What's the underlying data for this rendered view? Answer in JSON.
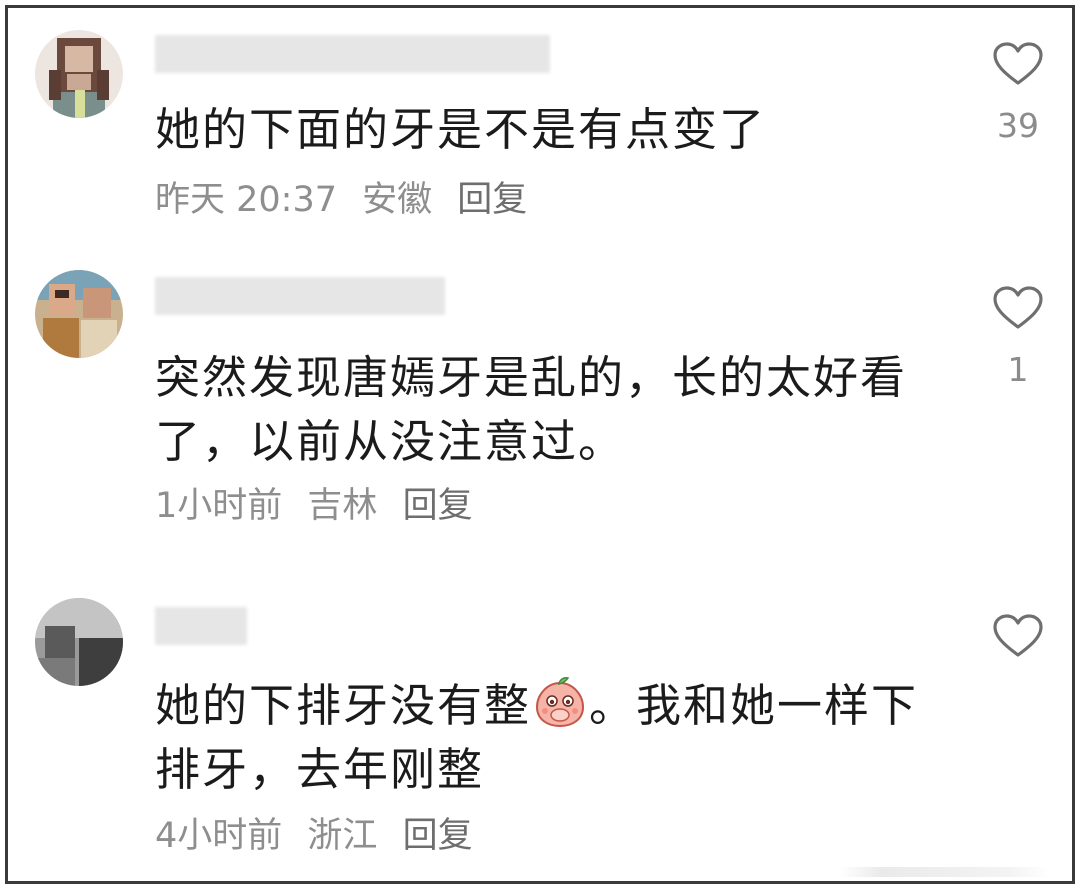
{
  "comments": [
    {
      "text": "她的下面的牙是不是有点变了",
      "time": "昨天 20:37",
      "location": "安徽",
      "reply": "回复",
      "likes": "39",
      "avatar_icon": "user-avatar-icon"
    },
    {
      "text": "突然发现唐嫣牙是乱的，长的太好看了，以前从没注意过。",
      "time": "1小时前",
      "location": "吉林",
      "reply": "回复",
      "likes": "1",
      "avatar_icon": "user-avatar-icon"
    },
    {
      "text_before_emoji": "她的下排牙没有整",
      "text_after_emoji": "。我和她一样下排牙，去年刚整",
      "emoji_icon": "peach-cover-mouth-emoji-icon",
      "time": "4小时前",
      "location": "浙江",
      "reply": "回复",
      "likes": "",
      "avatar_icon": "user-avatar-icon"
    }
  ],
  "colors": {
    "frame_border": "#3a3a3a",
    "text": "#1b1b1b",
    "meta": "#8e8e8e",
    "heart_stroke": "#6f6f6f"
  }
}
